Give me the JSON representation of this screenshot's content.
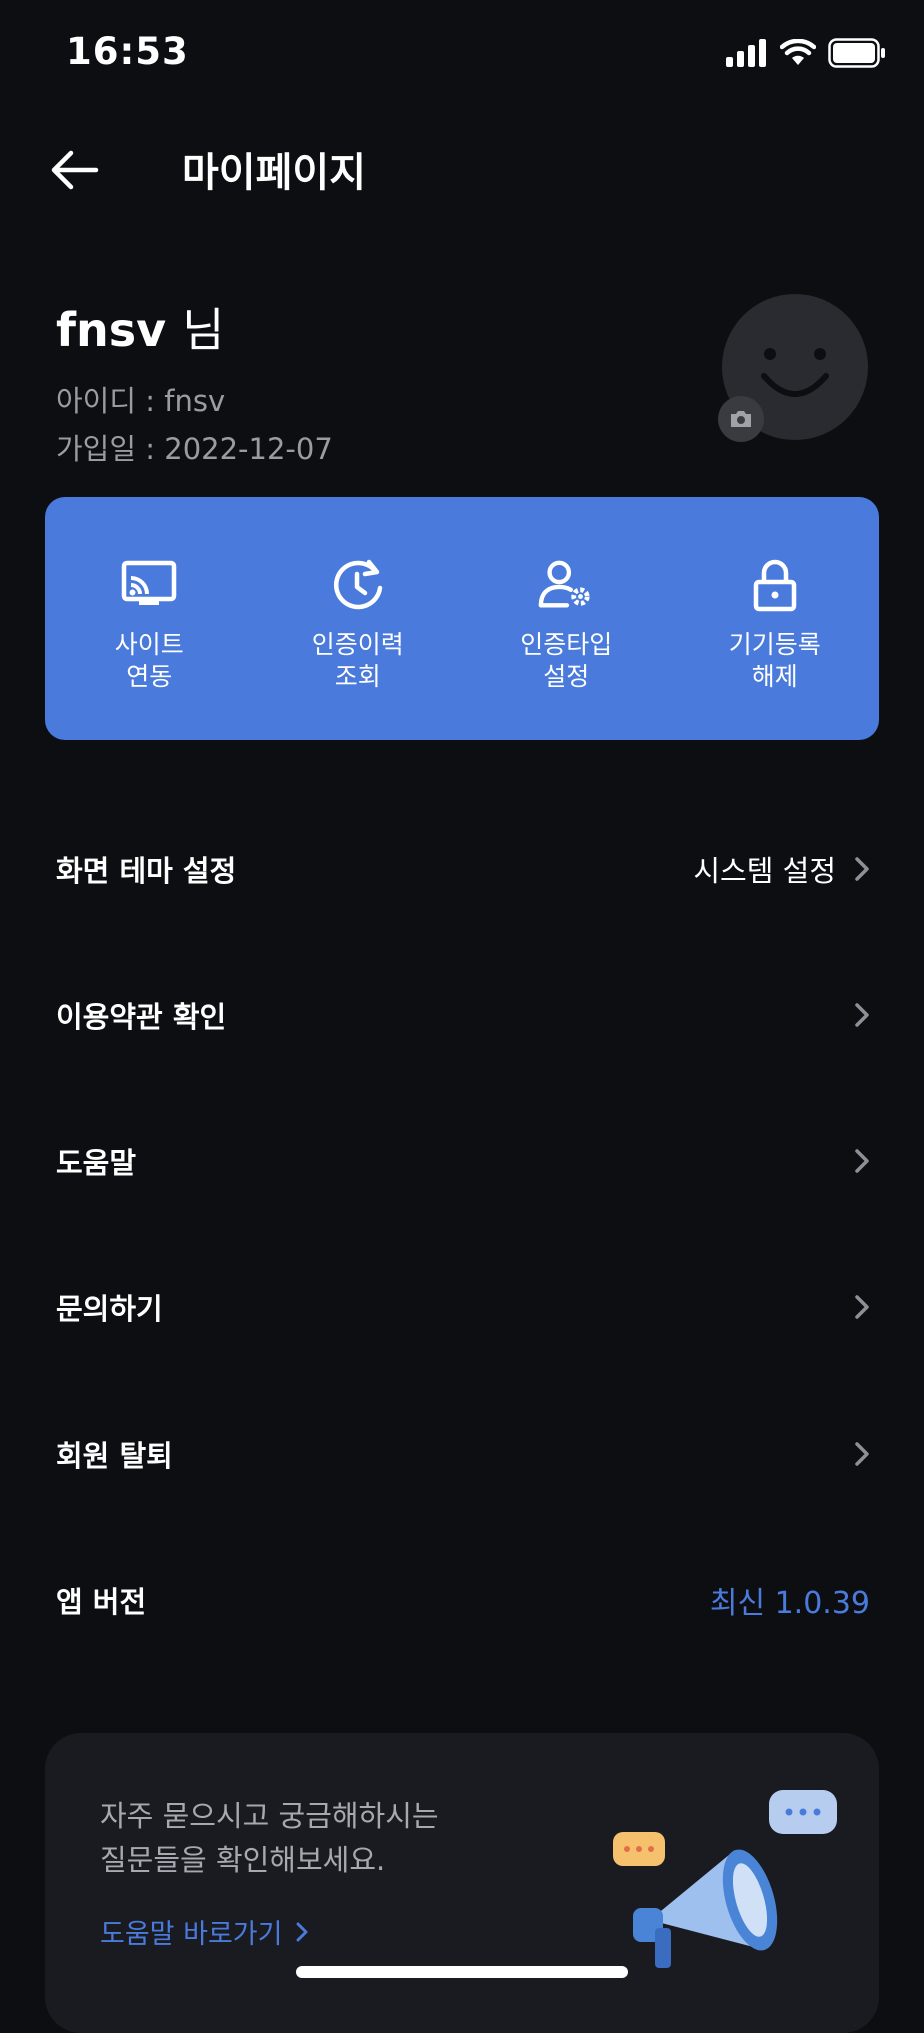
{
  "status_bar": {
    "time": "16:53"
  },
  "header": {
    "title": "마이페이지"
  },
  "profile": {
    "name": "fnsv",
    "name_suffix": "님",
    "id_line": "아이디 : fnsv",
    "joined_line": "가입일 : 2022-12-07"
  },
  "quick_menu": [
    {
      "label": "사이트\n연동",
      "icon": "cast-icon"
    },
    {
      "label": "인증이력\n조회",
      "icon": "history-icon"
    },
    {
      "label": "인증타입\n설정",
      "icon": "user-settings-icon"
    },
    {
      "label": "기기등록\n해제",
      "icon": "lock-icon"
    }
  ],
  "menu": {
    "theme": {
      "label": "화면 테마 설정",
      "value": "시스템 설정"
    },
    "terms": {
      "label": "이용약관 확인"
    },
    "help": {
      "label": "도움말"
    },
    "inquiry": {
      "label": "문의하기"
    },
    "withdraw": {
      "label": "회원 탈퇴"
    },
    "version": {
      "label": "앱 버전",
      "value": "최신 1.0.39"
    }
  },
  "help_card": {
    "text": "자주 묻으시고 궁금해하시는\n질문들을 확인해보세요.",
    "link": "도움말 바로가기"
  },
  "colors": {
    "accent": "#4a7bdc",
    "background": "#0d0e12",
    "card": "#1a1b20"
  }
}
